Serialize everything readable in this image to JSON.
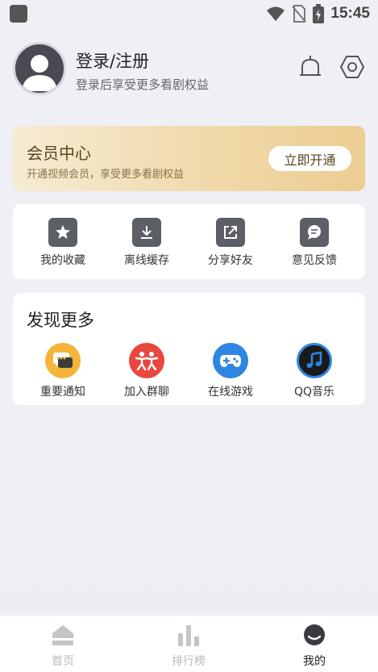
{
  "status_bar": {
    "time": "15:45"
  },
  "profile": {
    "title": "登录/注册",
    "subtitle": "登录后享受更多看剧权益"
  },
  "vip": {
    "title": "会员中心",
    "subtitle": "开通视频会员，享受更多看剧权益",
    "button": "立即开通"
  },
  "quick_actions": [
    {
      "label": "我的收藏",
      "icon": "star-icon"
    },
    {
      "label": "离线缓存",
      "icon": "download-icon"
    },
    {
      "label": "分享好友",
      "icon": "share-icon"
    },
    {
      "label": "意见反馈",
      "icon": "feedback-icon"
    }
  ],
  "discover": {
    "title": "发现更多",
    "items": [
      {
        "label": "重要通知",
        "icon": "chat-bubble-icon",
        "color": "#f5b53a"
      },
      {
        "label": "加入群聊",
        "icon": "group-icon",
        "color": "#e8473f"
      },
      {
        "label": "在线游戏",
        "icon": "gamepad-icon",
        "color": "#2f86e0"
      },
      {
        "label": "QQ音乐",
        "icon": "music-note-icon",
        "color": "#1a1a1a"
      }
    ]
  },
  "tabbar": {
    "tabs": [
      {
        "label": "首页",
        "icon": "home-icon",
        "active": false
      },
      {
        "label": "排行榜",
        "icon": "bar-chart-icon",
        "active": false
      },
      {
        "label": "我的",
        "icon": "user-face-icon",
        "active": true
      }
    ]
  }
}
